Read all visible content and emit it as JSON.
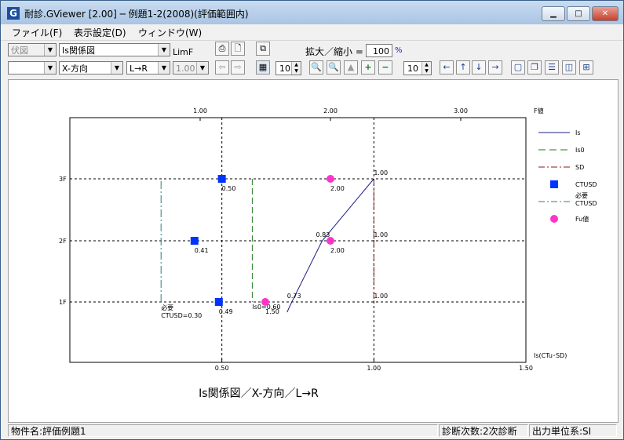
{
  "window": {
    "title": "耐診.GViewer [2.00] ─ 例題1-2(2008)(評価範囲内)",
    "minimize": "▁",
    "maximize": "□",
    "close": "✕"
  },
  "menu": {
    "file": "ファイル(F)",
    "view": "表示設定(D)",
    "window": "ウィンドウ(W)"
  },
  "toolbar": {
    "row1": {
      "view_select": "伏図",
      "chart_select": "Is関係図",
      "limf_label": "LimF",
      "zoom_label": "拡大／縮小 =",
      "zoom_value": "100",
      "zoom_unit": "%"
    },
    "row2": {
      "blank_select": "",
      "direction_select": "X-方向",
      "lr_select": "L→R",
      "limf_select": "1.00",
      "step_value": "10",
      "move_step_value": "10"
    }
  },
  "chart_data": {
    "type": "scatter",
    "title": "Is関係図／X-方向／L→R",
    "xlabel": "Is(CTu･SD)",
    "x2label": "F値",
    "x_ticks": [
      "0.50",
      "1.00",
      "1.50"
    ],
    "x2_ticks": [
      "1.00",
      "2.00",
      "3.00"
    ],
    "y_ticks": [
      "1F",
      "2F",
      "3F"
    ],
    "xlim": [
      0,
      1.5
    ],
    "x2lim": [
      0,
      3.5
    ],
    "legend": [
      {
        "name": "Is",
        "style": "solid",
        "color": "#1c1c8c"
      },
      {
        "name": "Is0",
        "style": "dash",
        "color": "#1f7a1f"
      },
      {
        "name": "SD",
        "style": "dashdot",
        "color": "#8b1a1a"
      },
      {
        "name": "CTUSD",
        "style": "square",
        "color": "#0033ff"
      },
      {
        "name": "必要CTUSD",
        "style": "dashdot",
        "color": "#2a7f7f"
      },
      {
        "name": "Fu値",
        "style": "circle",
        "color": "#ff33cc"
      }
    ],
    "series": [
      {
        "name": "Is",
        "points": [
          [
            0.73,
            1
          ],
          [
            0.83,
            2
          ],
          [
            1.0,
            3
          ]
        ],
        "labels": [
          "0.73",
          "0.83",
          "1.00"
        ]
      },
      {
        "name": "Is0",
        "value": 0.6,
        "label": "Is0=0.60"
      },
      {
        "name": "SD",
        "value": 1.0,
        "labels": [
          "1.00",
          "1.00",
          "1.00"
        ]
      },
      {
        "name": "CTUSD",
        "points": [
          [
            0.49,
            1
          ],
          [
            0.41,
            2
          ],
          [
            0.5,
            3
          ]
        ],
        "labels": [
          "0.49",
          "0.41",
          "0.50"
        ]
      },
      {
        "name": "必要CTUSD",
        "value": 0.3,
        "label_line1": "必要",
        "label_line2": "CTUSD=0.30"
      },
      {
        "name": "Fu値",
        "points": [
          [
            1.5,
            1
          ],
          [
            2.0,
            2
          ],
          [
            2.0,
            3
          ]
        ],
        "labels": [
          "1.50",
          "2.00",
          "2.00"
        ]
      }
    ]
  },
  "status": {
    "property_name": "物件名:評価例題1",
    "diagnosis_order": "診断次数:2次診断",
    "output_units": "出力単位系:SI"
  }
}
